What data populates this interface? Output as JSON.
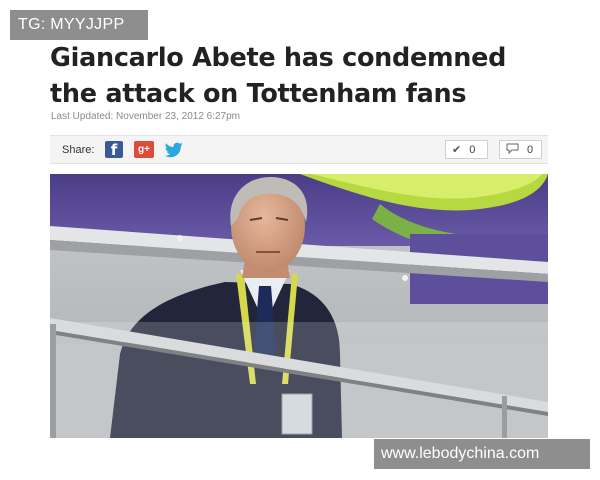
{
  "overlay": {
    "tag": "TG: MYYJJPP"
  },
  "article": {
    "headline": "Giancarlo Abete has condemned the attack on Tottenham fans",
    "updated": "Last Updated: November 23, 2012 6:27pm"
  },
  "share": {
    "label": "Share:",
    "facebook_icon": "facebook-icon",
    "googleplus_icon": "google-plus-icon",
    "twitter_icon": "twitter-bird-icon",
    "googleplus_text": "g+",
    "facebook_text": "f",
    "like_count": "0",
    "comment_count": "0",
    "colors": {
      "facebook": "#3b5998",
      "googleplus": "#dd4b39",
      "twitter": "#2aa9e0"
    }
  },
  "photo": {
    "subject": "photo-man-in-suit-at-stadium"
  },
  "watermark": {
    "text": "www.lebodychina.com"
  }
}
